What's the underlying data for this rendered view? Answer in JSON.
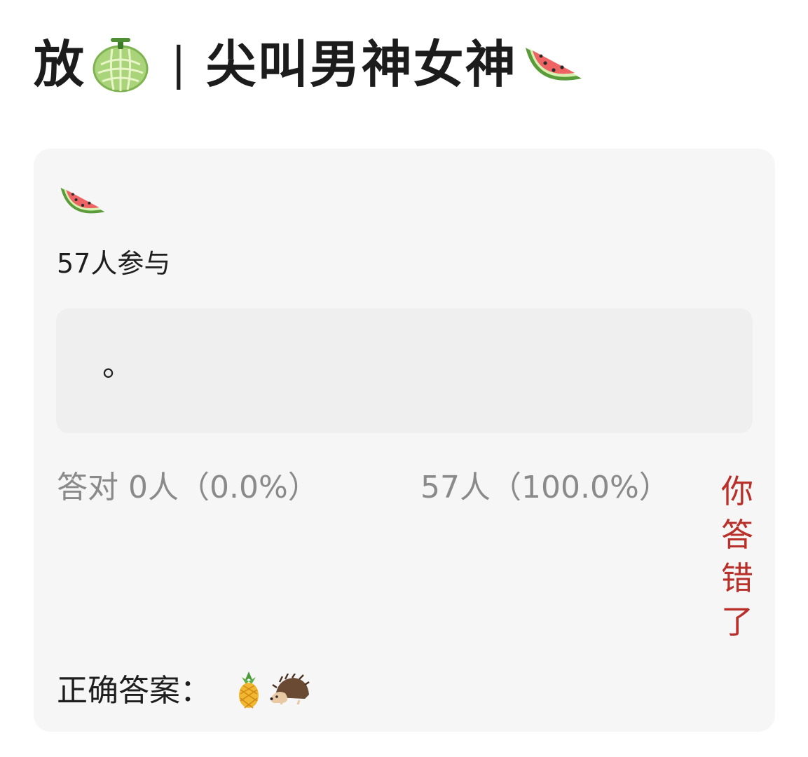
{
  "title": {
    "prefix": "放",
    "separator": "|",
    "main": "尖叫男神女神",
    "prefix_icon": "melon-icon",
    "suffix_icon": "watermelon-icon"
  },
  "quiz": {
    "question_icon": "watermelon-icon",
    "participants": "57人参与",
    "option_text": "。",
    "correct_stat": "答对  0人（0.0%）",
    "wrong_stat": "57人（100.0%）",
    "result": "你答错了",
    "answer_label": "正确答案：",
    "answer_icons": [
      "pineapple-icon",
      "hedgehog-icon"
    ]
  },
  "colors": {
    "card_bg": "#f6f6f6",
    "option_bg": "#efefef",
    "stat_text": "#8a8a8a",
    "result_text": "#b9302a"
  }
}
